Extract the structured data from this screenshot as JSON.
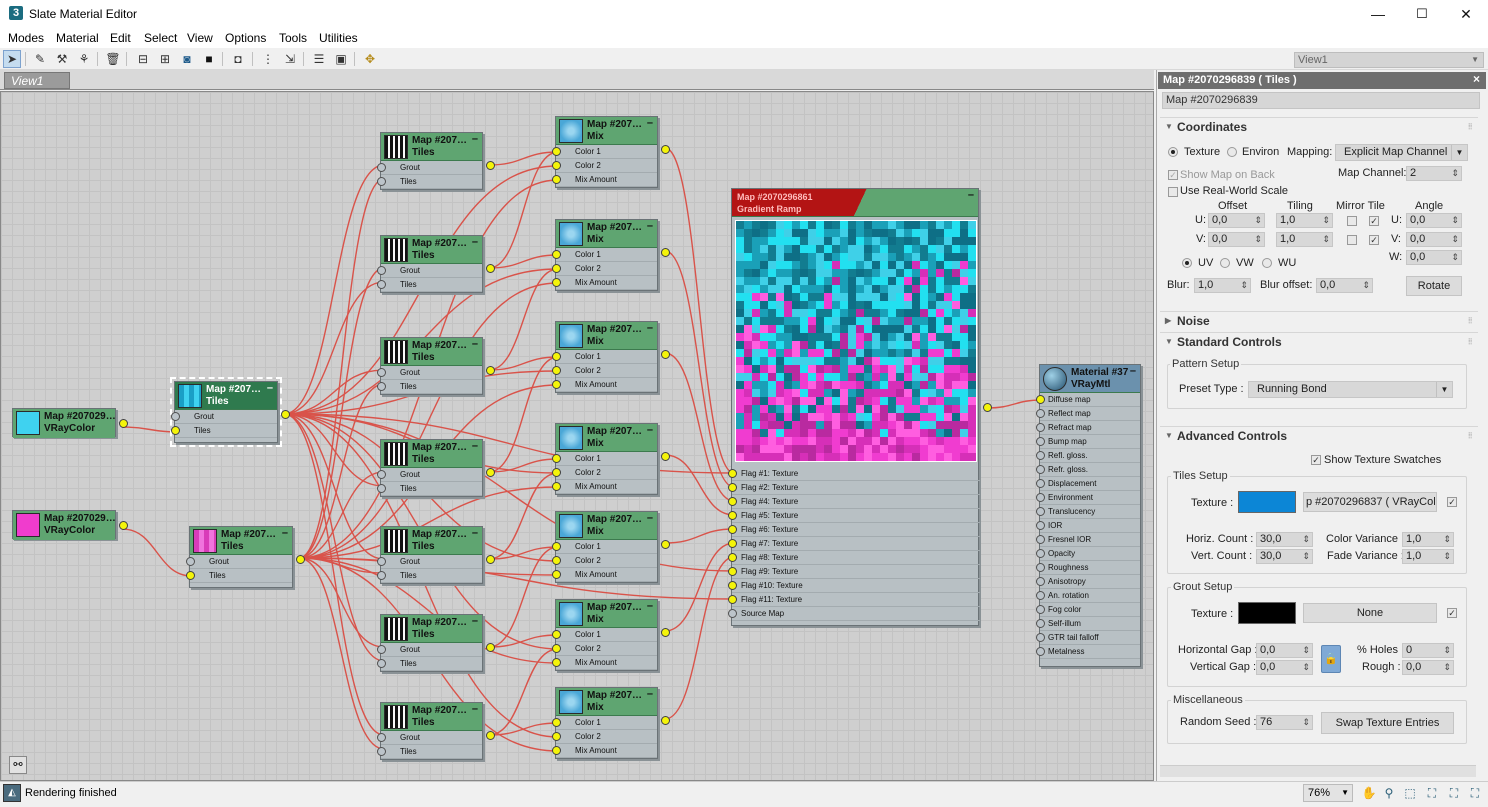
{
  "window": {
    "title": "Slate Material Editor",
    "app_icon": "3",
    "min": "—",
    "max": "☐",
    "close": "✕"
  },
  "menu": [
    "Modes",
    "Material",
    "Edit",
    "Select",
    "View",
    "Options",
    "Tools",
    "Utilities"
  ],
  "toolbar": {
    "view_select": "View1",
    "icons": [
      "select-arrow-icon",
      "eyedropper-icon",
      "pick-material-icon",
      "assign-material-icon",
      "delete-icon",
      "layout-all-icon",
      "layout-children-icon",
      "hide-unused-icon",
      "background-icon",
      "lock-view-icon",
      "move-children-icon",
      "hide-node-icon",
      "show-map-icon",
      "show-in-viewport-icon",
      "navigator-icon"
    ]
  },
  "view": {
    "tab": "View1"
  },
  "nodes": {
    "vraycolor1": {
      "t1": "Map #207029…",
      "t2": "VRayColor",
      "color": "#3fd2f0"
    },
    "vraycolor2": {
      "t1": "Map #207029…",
      "t2": "VRayColor",
      "color": "#f03ccd"
    },
    "tiles_sel": {
      "t1": "Map #207…",
      "t2": "Tiles",
      "slots": [
        "Grout",
        "Tiles"
      ]
    },
    "tiles_pink": {
      "t1": "Map #207…",
      "t2": "Tiles",
      "slots": [
        "Grout",
        "Tiles"
      ]
    },
    "tiles_col": [
      {
        "t1": "Map #207…",
        "t2": "Tiles",
        "slots": [
          "Grout",
          "Tiles"
        ]
      },
      {
        "t1": "Map #207…",
        "t2": "Tiles",
        "slots": [
          "Grout",
          "Tiles"
        ]
      },
      {
        "t1": "Map #207…",
        "t2": "Tiles",
        "slots": [
          "Grout",
          "Tiles"
        ]
      },
      {
        "t1": "Map #207…",
        "t2": "Tiles",
        "slots": [
          "Grout",
          "Tiles"
        ]
      },
      {
        "t1": "Map #207…",
        "t2": "Tiles",
        "slots": [
          "Grout",
          "Tiles"
        ]
      },
      {
        "t1": "Map #207…",
        "t2": "Tiles",
        "slots": [
          "Grout",
          "Tiles"
        ]
      },
      {
        "t1": "Map #207…",
        "t2": "Tiles",
        "slots": [
          "Grout",
          "Tiles"
        ]
      }
    ],
    "mix_col": [
      {
        "t1": "Map #207…",
        "t2": "Mix",
        "slots": [
          "Color 1",
          "Color 2",
          "Mix Amount"
        ]
      },
      {
        "t1": "Map #207…",
        "t2": "Mix",
        "slots": [
          "Color 1",
          "Color 2",
          "Mix Amount"
        ]
      },
      {
        "t1": "Map #207…",
        "t2": "Mix",
        "slots": [
          "Color 1",
          "Color 2",
          "Mix Amount"
        ]
      },
      {
        "t1": "Map #207…",
        "t2": "Mix",
        "slots": [
          "Color 1",
          "Color 2",
          "Mix Amount"
        ]
      },
      {
        "t1": "Map #207…",
        "t2": "Mix",
        "slots": [
          "Color 1",
          "Color 2",
          "Mix Amount"
        ]
      },
      {
        "t1": "Map #207…",
        "t2": "Mix",
        "slots": [
          "Color 1",
          "Color 2",
          "Mix Amount"
        ]
      },
      {
        "t1": "Map #207…",
        "t2": "Mix",
        "slots": [
          "Color 1",
          "Color 2",
          "Mix Amount"
        ]
      }
    ],
    "gradient": {
      "t1": "Map #2070296861",
      "t2": "Gradient Ramp",
      "slots": [
        "Flag #1: Texture",
        "Flag #2: Texture",
        "Flag #4: Texture",
        "Flag #5: Texture",
        "Flag #6: Texture",
        "Flag #7: Texture",
        "Flag #8: Texture",
        "Flag #9: Texture",
        "Flag #10: Texture",
        "Flag #11: Texture",
        "Source Map"
      ]
    },
    "vraymtl": {
      "t1": "Material #37",
      "t2": "VRayMtl",
      "slots": [
        "Diffuse map",
        "Reflect map",
        "Refract map",
        "Bump map",
        "Refl. gloss.",
        "Refr. gloss.",
        "Displacement",
        "Environment",
        "Translucency",
        "IOR",
        "Fresnel IOR",
        "Opacity",
        "Roughness",
        "Anisotropy",
        "An. rotation",
        "Fog color",
        "Self-illum",
        "GTR tail falloff",
        "Metalness"
      ]
    }
  },
  "panel": {
    "title": "Map #2070296839  ( Tiles )",
    "close": "×",
    "name": "Map #2070296839",
    "coordinates": {
      "header": "Coordinates",
      "texture": "Texture",
      "environ": "Environ",
      "mapping_label": "Mapping:",
      "mapping": "Explicit Map Channel",
      "show_map_on_back": "Show Map on Back",
      "map_channel_label": "Map Channel:",
      "map_channel": "2",
      "use_real_world": "Use Real-World Scale",
      "offset": "Offset",
      "tiling": "Tiling",
      "mirror_tile": "Mirror Tile",
      "angle": "Angle",
      "u": "U:",
      "v": "V:",
      "w": "W:",
      "u_offset": "0,0",
      "u_tiling": "1,0",
      "u_angle": "0,0",
      "v_offset": "0,0",
      "v_tiling": "1,0",
      "v_angle": "0,0",
      "w_angle": "0,0",
      "uv": "UV",
      "vw": "VW",
      "wu": "WU",
      "blur_label": "Blur:",
      "blur": "1,0",
      "blur_offset_label": "Blur offset:",
      "blur_offset": "0,0",
      "rotate": "Rotate"
    },
    "noise": {
      "header": "Noise"
    },
    "standard": {
      "header": "Standard Controls",
      "pattern_setup": "Pattern Setup",
      "preset_label": "Preset Type :",
      "preset": "Running Bond"
    },
    "advanced": {
      "header": "Advanced Controls",
      "show_swatches": "Show Texture Swatches",
      "tiles_setup": "Tiles Setup",
      "texture_label": "Texture :",
      "tiles_texture_color": "#0c86d6",
      "tiles_map": "p #2070296837  ( VRayColo",
      "horiz_count_label": "Horiz. Count :",
      "horiz_count": "30,0",
      "vert_count_label": "Vert. Count :",
      "vert_count": "30,0",
      "color_variance_label": "Color Variance :",
      "color_variance": "1,0",
      "fade_variance_label": "Fade Variance :",
      "fade_variance": "1,0",
      "grout_setup": "Grout Setup",
      "grout_texture_label": "Texture :",
      "grout_texture_color": "#000000",
      "grout_map": "None",
      "hgap_label": "Horizontal Gap :",
      "hgap": "0,0",
      "vgap_label": "Vertical Gap :",
      "vgap": "0,0",
      "holes_label": "% Holes :",
      "holes": "0",
      "rough_label": "Rough :",
      "rough": "0,0",
      "misc": "Miscellaneous",
      "random_seed_label": "Random Seed :",
      "random_seed": "76",
      "swap": "Swap Texture Entries"
    }
  },
  "status": {
    "text": "Rendering finished",
    "zoom": "76%"
  }
}
